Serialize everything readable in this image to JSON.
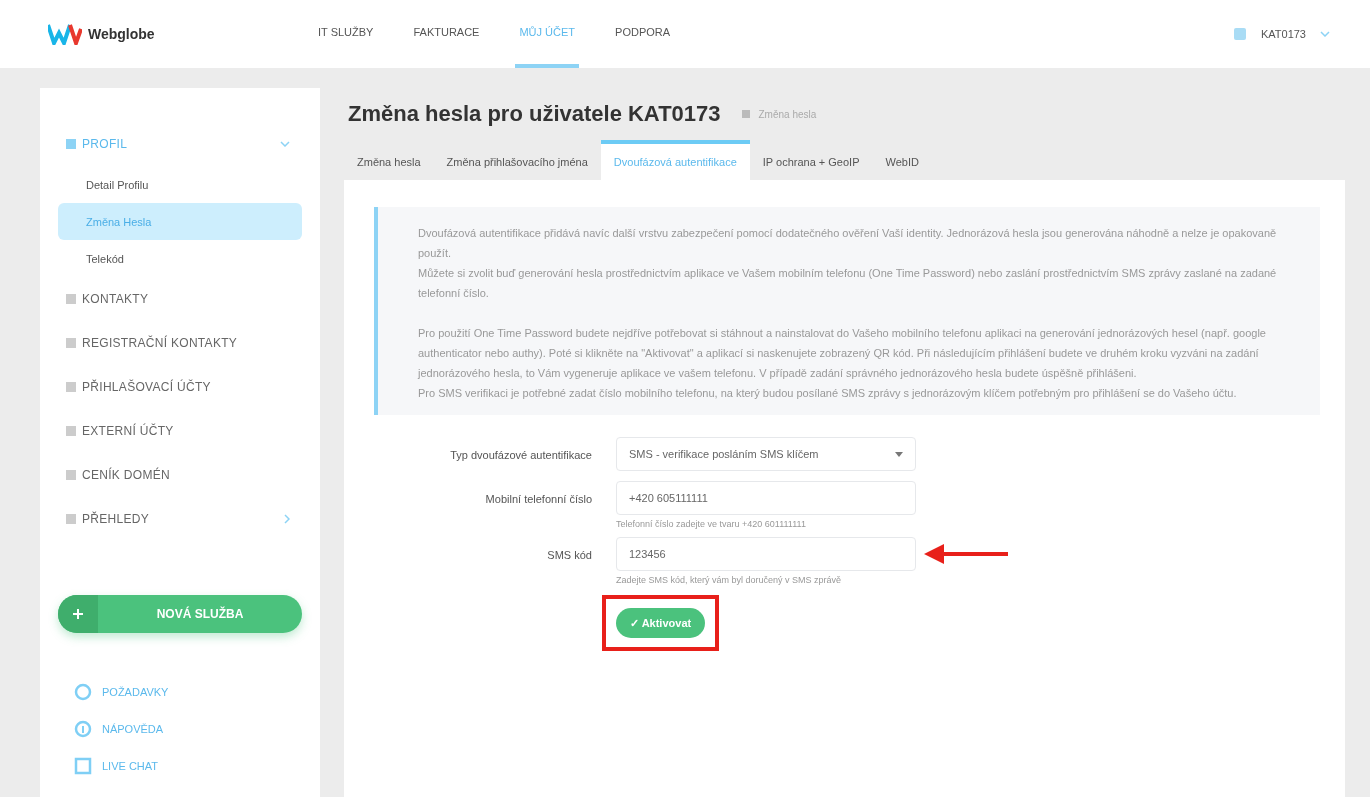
{
  "header": {
    "logo": "Webglobe",
    "nav": [
      {
        "label": "IT SLUŽBY",
        "selected": false
      },
      {
        "label": "FAKTURACE",
        "selected": false
      },
      {
        "label": "MŮJ ÚČET",
        "selected": true
      },
      {
        "label": "PODPORA",
        "selected": false
      }
    ],
    "user": "KAT0173"
  },
  "sidebar": {
    "items": [
      {
        "label": "PROFIL",
        "expanded": true,
        "children": [
          {
            "label": "Detail Profilu",
            "selected": false
          },
          {
            "label": "Změna Hesla",
            "selected": true
          },
          {
            "label": "Telekód",
            "selected": false
          }
        ]
      },
      {
        "label": "KONTAKTY"
      },
      {
        "label": "REGISTRAČNÍ KONTAKTY"
      },
      {
        "label": "PŘIHLAŠOVACÍ ÚČTY"
      },
      {
        "label": "EXTERNÍ ÚČTY"
      },
      {
        "label": "CENÍK DOMÉN"
      },
      {
        "label": "PŘEHLEDY",
        "expanded": false
      }
    ],
    "new_service_button": "NOVÁ SLUŽBA",
    "links": [
      {
        "label": "POŽADAVKY",
        "kind": "help"
      },
      {
        "label": "NÁPOVĚDA",
        "kind": "info"
      },
      {
        "label": "LIVE CHAT",
        "kind": "chat"
      }
    ]
  },
  "page": {
    "title": "Změna hesla pro uživatele KAT0173",
    "breadcrumb": "Změna hesla",
    "tabs": [
      {
        "label": "Změna hesla",
        "selected": false
      },
      {
        "label": "Změna přihlašovacího jména",
        "selected": false
      },
      {
        "label": "Dvoufázová autentifikace",
        "selected": true
      },
      {
        "label": "IP ochrana + GeoIP",
        "selected": false
      },
      {
        "label": "WebID",
        "selected": false
      }
    ],
    "info": [
      [
        "Dvoufázová autentifikace přidává navíc další vrstvu zabezpečení pomocí dodatečného ověření Vaší identity. Jednorázová hesla jsou generována náhodně a nelze je opakovaně použít.",
        "Můžete si zvolit buď generování hesla prostřednictvím aplikace ve Vašem mobilním telefonu (One Time Password) nebo zaslání prostřednictvím SMS zprávy zaslané na zadané telefonní číslo."
      ],
      [
        "Pro použití One Time Password budete nejdříve potřebovat si stáhnout a nainstalovat do Vašeho mobilního telefonu aplikaci na generování jednorázových hesel (např. google authenticator nebo authy). Poté si klikněte na \"Aktivovat\" a aplikací si naskenujete zobrazený QR kód. Při následujícím přihlášení budete ve druhém kroku vyzváni na zadání jednorázového hesla, to Vám vygeneruje aplikace ve vašem telefonu. V případě zadání správného jednorázového hesla budete úspěšně přihlášeni.",
        "Pro SMS verifikaci je potřebné zadat číslo mobilního telefonu, na který budou posílané SMS zprávy s jednorázovým klíčem potřebným pro přihlášení se do Vašeho účtu."
      ]
    ],
    "form": [
      {
        "kind": "select",
        "label": "Typ dvoufázové autentifikace",
        "value": "SMS - verifikace posláním SMS klíčem"
      },
      {
        "kind": "input",
        "label": "Mobilní telefonní číslo",
        "value": "+420 605111111",
        "hint": "Telefonní číslo zadejte ve tvaru +420 601111111"
      },
      {
        "kind": "input",
        "label": "SMS kód",
        "value": "123456",
        "hint": "Zadejte SMS kód, který vám byl doručený v SMS zprávě",
        "arrow": true
      }
    ],
    "submit": {
      "label": "✓ Aktivovat",
      "highlighted": true
    }
  }
}
